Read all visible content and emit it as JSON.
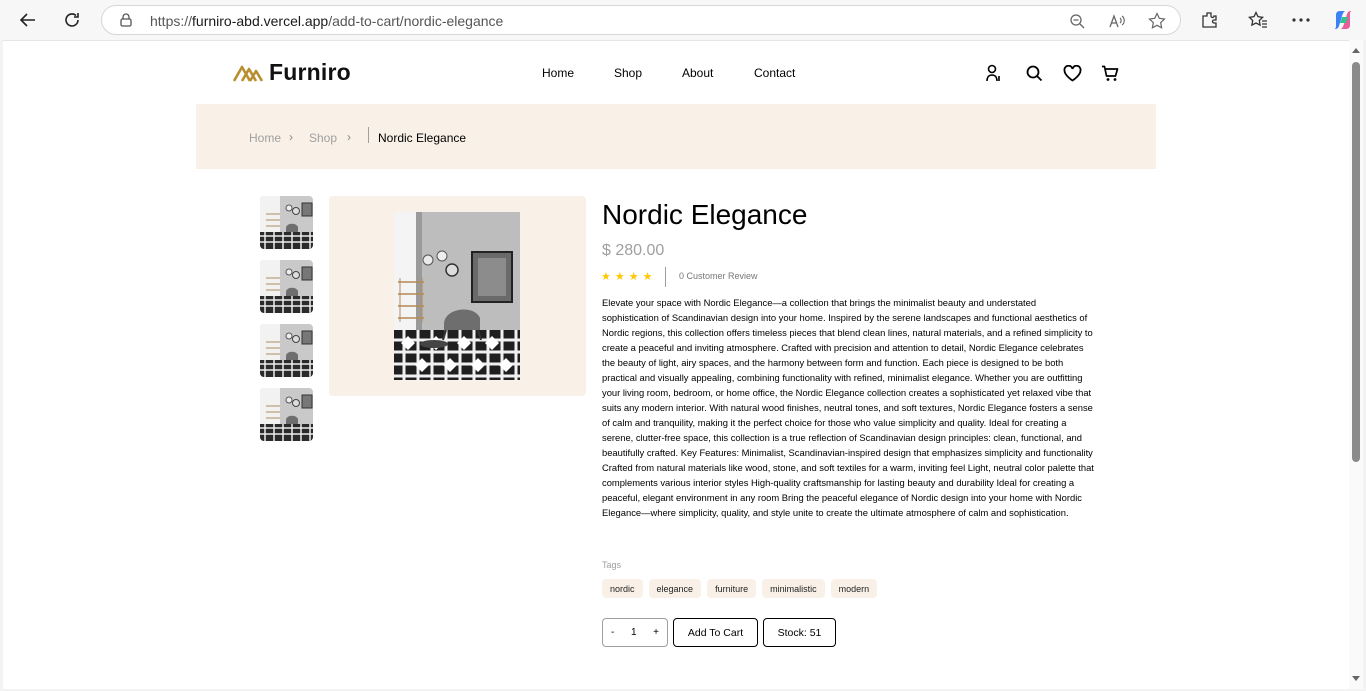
{
  "browser": {
    "url_prefix": "https://",
    "url_host": "furniro-abd.vercel.app",
    "url_path": "/add-to-cart/nordic-elegance"
  },
  "header": {
    "logo_text": "Furniro",
    "nav": [
      "Home",
      "Shop",
      "About",
      "Contact"
    ]
  },
  "breadcrumb": {
    "items": [
      "Home",
      "Shop"
    ],
    "current": "Nordic Elegance"
  },
  "product": {
    "title": "Nordic Elegance",
    "price": "$ 280.00",
    "stars": "★★★★",
    "rating": 4,
    "reviews": "0 Customer Review",
    "description": "Elevate your space with Nordic Elegance—a collection that brings the minimalist beauty and understated sophistication of Scandinavian design into your home. Inspired by the serene landscapes and functional aesthetics of Nordic regions, this collection offers timeless pieces that blend clean lines, natural materials, and a refined simplicity to create a peaceful and inviting atmosphere. Crafted with precision and attention to detail, Nordic Elegance celebrates the beauty of light, airy spaces, and the harmony between form and function. Each piece is designed to be both practical and visually appealing, combining functionality with refined, minimalist elegance. Whether you are outfitting your living room, bedroom, or home office, the Nordic Elegance collection creates a sophisticated yet relaxed vibe that suits any modern interior. With natural wood finishes, neutral tones, and soft textures, Nordic Elegance fosters a sense of calm and tranquility, making it the perfect choice for those who value simplicity and quality. Ideal for creating a serene, clutter-free space, this collection is a true reflection of Scandinavian design principles: clean, functional, and beautifully crafted. Key Features: Minimalist, Scandinavian-inspired design that emphasizes simplicity and functionality Crafted from natural materials like wood, stone, and soft textiles for a warm, inviting feel Light, neutral color palette that complements various interior styles High-quality craftsmanship for lasting beauty and durability Ideal for creating a peaceful, elegant environment in any room Bring the peaceful elegance of Nordic design into your home with Nordic Elegance—where simplicity, quality, and style unite to create the ultimate atmosphere of calm and sophistication.",
    "tags_label": "Tags",
    "tags": [
      "nordic",
      "elegance",
      "furniture",
      "minimalistic",
      "modern"
    ],
    "qty_minus": "-",
    "qty_value": "1",
    "qty_plus": "+",
    "add_to_cart": "Add To Cart",
    "stock": "Stock: 51"
  },
  "colors": {
    "accent_bg": "#f9f1e7",
    "star": "#ffc700",
    "logo_gold": "#b88e2f",
    "muted_text": "#9f9f9f"
  }
}
